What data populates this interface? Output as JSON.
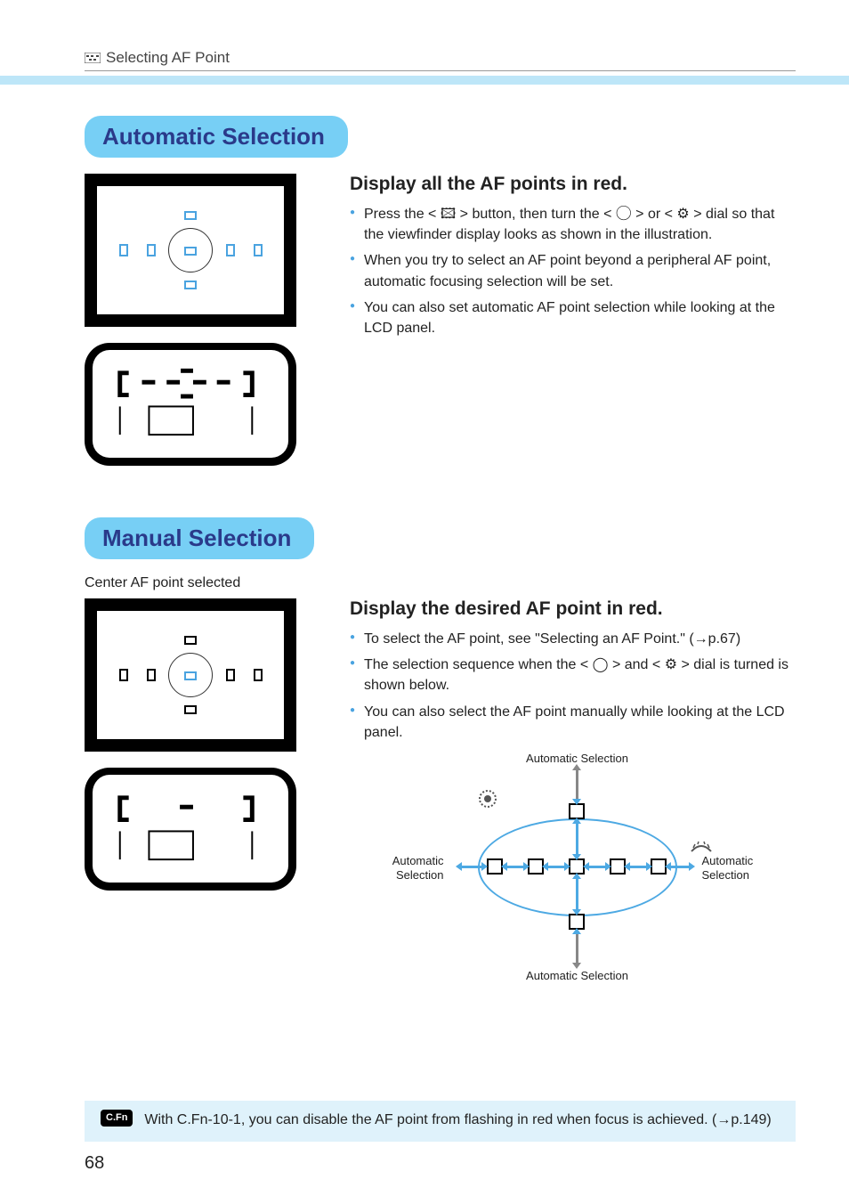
{
  "header": {
    "title": "Selecting AF Point"
  },
  "page_number": "68",
  "section1": {
    "heading": "Automatic Selection",
    "desc_heading": "Display all the AF points in red.",
    "bullets": [
      "Press the < 🖾 > button, then turn the < ◯ > or < ⚙ > dial so that the viewfinder display looks as shown in the illustration.",
      "When you try to select an AF point beyond a peripheral AF point, automatic focusing selection will be set.",
      "You can also set automatic AF point selection while looking at the LCD panel."
    ]
  },
  "section2": {
    "heading": "Manual Selection",
    "caption": "Center AF point selected",
    "desc_heading": "Display the desired AF point in red.",
    "bullets": [
      "To select the AF point, see \"Selecting an AF Point.\" (→p.67)",
      "The selection sequence when the < ◯ > and < ⚙ > dial is turned is shown below.",
      "You can also select the AF point manually while looking at the LCD panel."
    ],
    "diagram_labels": {
      "top": "Automatic Selection",
      "bottom": "Automatic Selection",
      "left": "Automatic Selection",
      "right": "Automatic Selection"
    }
  },
  "note": {
    "badge": "C.Fn",
    "text": "With C.Fn-10-1, you can disable the AF point from flashing in red when focus is achieved. (→p.149)"
  }
}
